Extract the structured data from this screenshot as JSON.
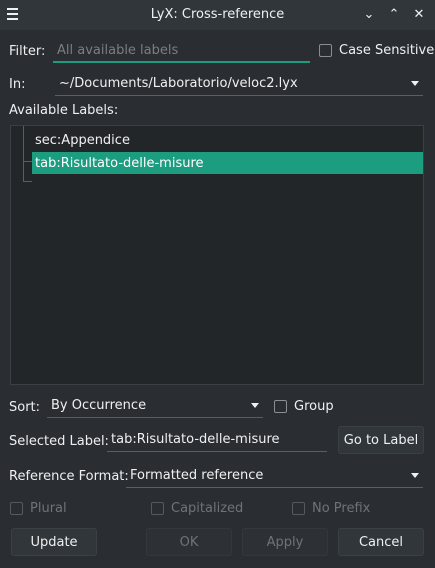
{
  "window": {
    "title": "LyX: Cross-reference",
    "minimize_glyph": "⌄",
    "maximize_glyph": "⌃",
    "close_glyph": "✕"
  },
  "filter": {
    "label": "Filter:",
    "placeholder": "All available labels",
    "case_sensitive_label": "Case Sensitive"
  },
  "in": {
    "label": "In:",
    "value": "~/Documents/Laboratorio/veloc2.lyx"
  },
  "labels": {
    "heading": "Available Labels:",
    "items": [
      {
        "text": "sec:Appendice",
        "selected": false
      },
      {
        "text": "tab:Risultato-delle-misure",
        "selected": true
      }
    ]
  },
  "sort": {
    "label": "Sort:",
    "value": "By Occurrence",
    "group_label": "Group"
  },
  "selected_label": {
    "label": "Selected Label:",
    "value": "tab:Risultato-delle-misure",
    "goto_button": "Go to Label"
  },
  "reference_format": {
    "label": "Reference Format:",
    "value": "Formatted reference"
  },
  "options": {
    "plural": "Plural",
    "capitalized": "Capitalized",
    "no_prefix": "No Prefix"
  },
  "buttons": {
    "update": "Update",
    "ok": "OK",
    "apply": "Apply",
    "cancel": "Cancel"
  },
  "colors": {
    "accent": "#1d9d80",
    "background": "#2a2e32",
    "titlebar": "#31363b"
  }
}
